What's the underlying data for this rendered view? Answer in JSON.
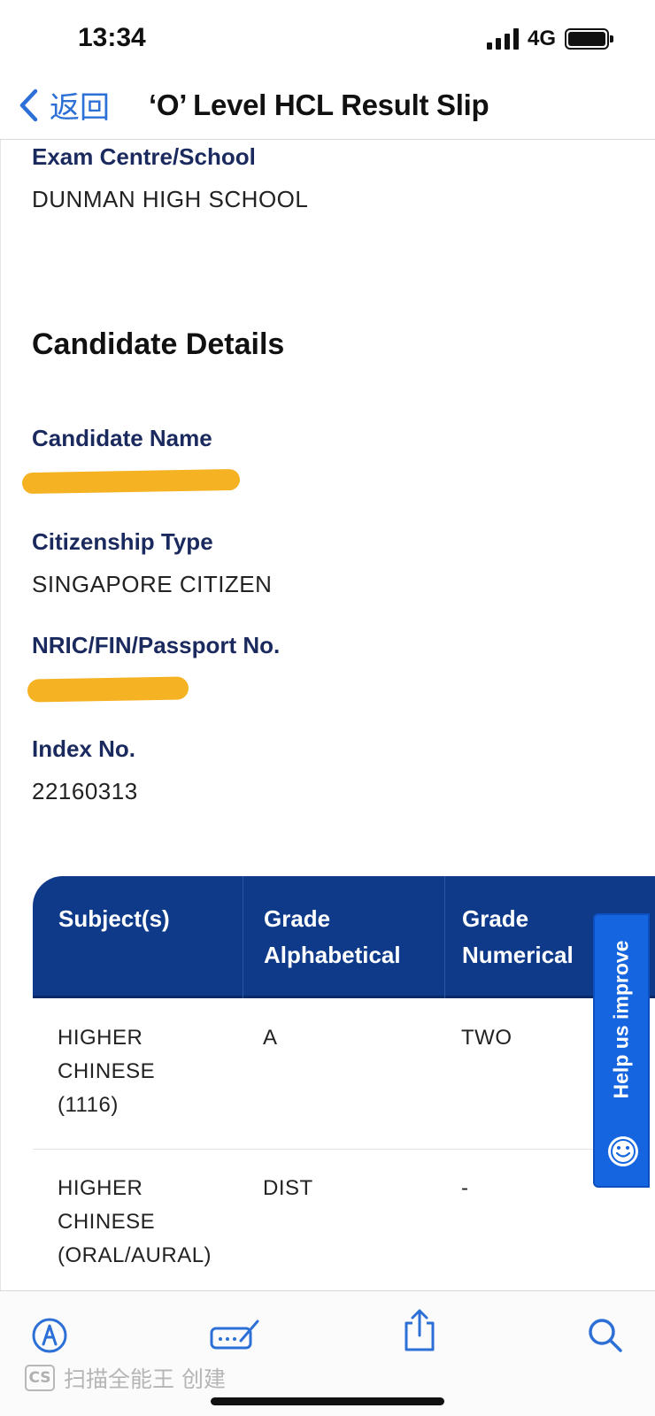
{
  "status_bar": {
    "time": "13:34",
    "network": "4G"
  },
  "nav": {
    "back_label": "返回",
    "title": "‘O’ Level HCL Result Slip"
  },
  "exam_centre": {
    "label": "Exam Centre/School",
    "value": "DUNMAN HIGH SCHOOL"
  },
  "candidate_section": {
    "heading": "Candidate Details"
  },
  "candidate_name": {
    "label": "Candidate Name"
  },
  "citizenship": {
    "label": "Citizenship Type",
    "value": "SINGAPORE CITIZEN"
  },
  "nric": {
    "label": "NRIC/FIN/Passport No."
  },
  "index_no": {
    "label": "Index No.",
    "value": "22160313"
  },
  "results_table": {
    "headers": [
      "Subject(s)",
      "Grade Alphabetical",
      "Grade Numerical"
    ],
    "rows": [
      {
        "subject": "HIGHER CHINESE (1116)",
        "grade_alpha": "A",
        "grade_num": "TWO"
      },
      {
        "subject": "HIGHER CHINESE (ORAL/AURAL)",
        "grade_alpha": "DIST",
        "grade_num": "-"
      }
    ]
  },
  "feedback_tab": {
    "label": "Help us improve"
  },
  "watermark": {
    "badge": "CS",
    "text": "扫描全能王 创建"
  },
  "colors": {
    "accent_blue": "#2c6fd6",
    "header_navy": "#0f3a8a",
    "label_navy": "#1b2a5e",
    "redaction": "#f5b223",
    "feedback_blue": "#1565e0"
  },
  "icons": [
    "back-chevron-icon",
    "markup-icon",
    "signature-icon",
    "share-icon",
    "search-icon",
    "smiley-icon"
  ]
}
